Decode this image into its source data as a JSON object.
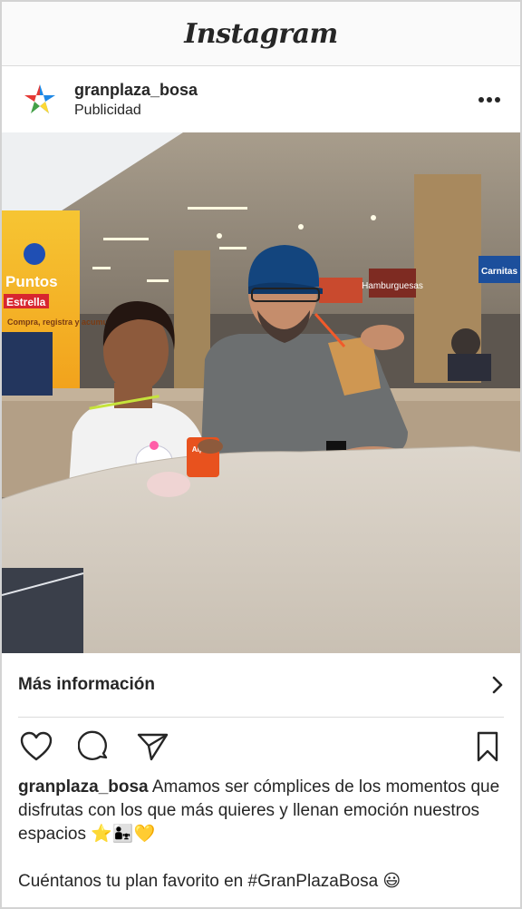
{
  "app": {
    "logo": "Instagram"
  },
  "post": {
    "username": "granplaza_bosa",
    "sponsored_label": "Publicidad",
    "more_icon": "more-horizontal-icon",
    "cta_label": "Más información",
    "cta_icon": "chevron-right-icon",
    "caption_username": "granplaza_bosa",
    "caption_text": "Amamos ser cómplices de los momentos que disfrutas con los que más quieres y llenan emoción nuestros espacios ⭐👨‍👧💛",
    "caption_text_2": "Cuéntanos tu plan favorito en #GranPlazaBosa 😃"
  },
  "photo": {
    "sign_title": "Puntos",
    "sign_subtitle": "Estrella",
    "sign_body": "Compra, registra y acumula",
    "store_1": "Hamburguesas",
    "store_2": "Carnitas",
    "cup_brand": "Alpina"
  },
  "actions": {
    "like_icon": "heart-icon",
    "comment_icon": "comment-icon",
    "share_icon": "paper-plane-icon",
    "save_icon": "bookmark-icon"
  },
  "colors": {
    "header_bg": "#fafafa",
    "text": "#262626",
    "divider": "#dbdbdb"
  }
}
